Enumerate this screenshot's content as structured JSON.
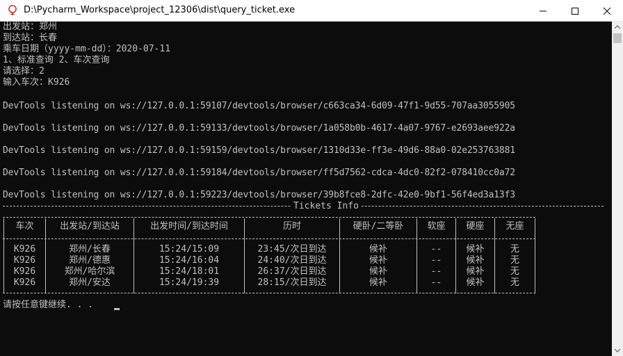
{
  "window": {
    "title": "D:\\Pycharm_Workspace\\project_12306\\dist\\query_ticket.exe",
    "app_icon": "python-exe-icon",
    "controls": [
      "minimize-icon",
      "maximize-icon",
      "close-icon"
    ]
  },
  "console": {
    "prompts": [
      "出发站：郑州",
      "到达站：长春",
      "乘车日期（yyyy-mm-dd）：2020-07-11",
      "1、标准查询 2、车次查询",
      "请选择：2",
      "输入车次：K926"
    ],
    "devtools_lines": [
      "DevTools listening on ws://127.0.0.1:59107/devtools/browser/c663ca34-6d09-47f1-9d55-707aa3055905",
      "DevTools listening on ws://127.0.0.1:59133/devtools/browser/1a058b0b-4617-4a07-9767-e2693aee922a",
      "DevTools listening on ws://127.0.0.1:59159/devtools/browser/1310d33e-ff3e-49d6-88a0-02e253763881",
      "DevTools listening on ws://127.0.0.1:59184/devtools/browser/ff5d7562-cdca-4dc0-82f2-078410cc0a72",
      "DevTools listening on ws://127.0.0.1:59223/devtools/browser/39b8fce8-2dfc-42e0-9bf1-56f4ed3a13f3"
    ],
    "table": {
      "title": "Tickets Info",
      "headers": [
        "车次",
        "出发站/到达站",
        "出发时间/到达时间",
        "历时",
        "硬卧/二等卧",
        "软座",
        "硬座",
        "无座"
      ],
      "rows": [
        [
          "K926",
          "郑州/长春",
          "15:24/15:09",
          "23:45/次日到达",
          "候补",
          "--",
          "候补",
          "无"
        ],
        [
          "K926",
          "郑州/德惠",
          "15:24/16:04",
          "24:40/次日到达",
          "候补",
          "--",
          "候补",
          "无"
        ],
        [
          "K926",
          "郑州/哈尔滨",
          "15:24/18:01",
          "26:37/次日到达",
          "候补",
          "--",
          "候补",
          "无"
        ],
        [
          "K926",
          "郑州/安达",
          "15:24/19:39",
          "28:15/次日到达",
          "候补",
          "--",
          "候补",
          "无"
        ]
      ]
    },
    "continue_prompt": "请按任意键继续. . .",
    "colors": {
      "background": "#0c0c0c",
      "text": "#c0c0c0"
    }
  }
}
